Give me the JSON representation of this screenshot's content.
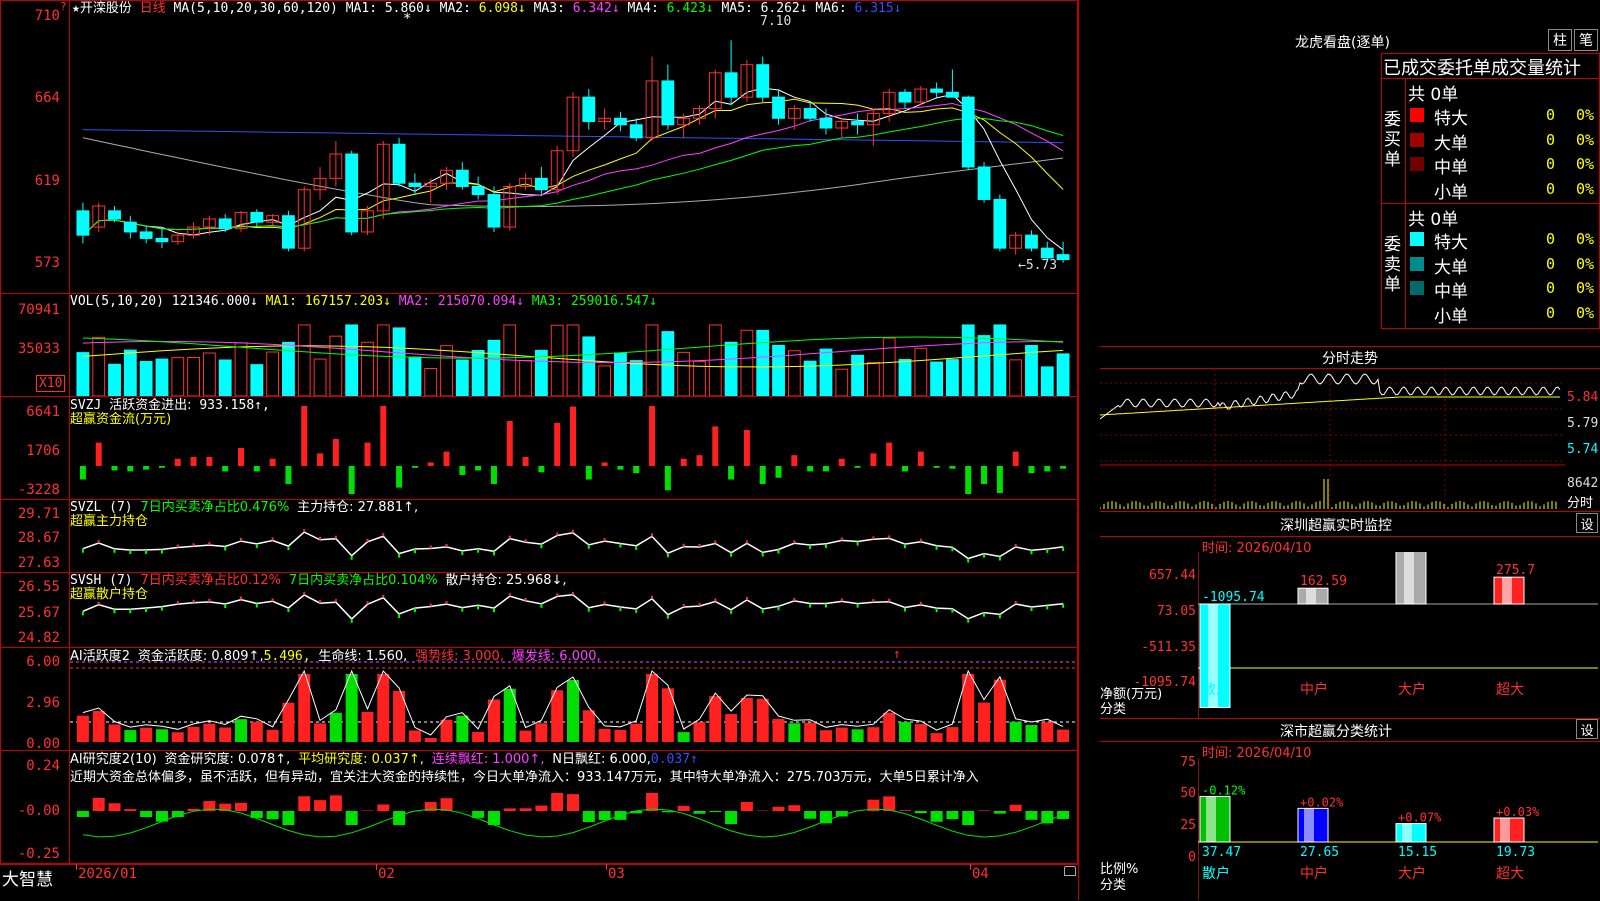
{
  "stock": {
    "star": "★",
    "name": "开滦股份",
    "period": "日线"
  },
  "main_panel": {
    "ma_header": "MA(5,10,20,30,60,120)",
    "ma": [
      {
        "label": "MA1:",
        "value": "5.860↓",
        "color": "#ffffff"
      },
      {
        "label": "MA2:",
        "value": "6.098↓",
        "color": "#ffff00"
      },
      {
        "label": "MA3:",
        "value": "6.342↓",
        "color": "#ff40ff"
      },
      {
        "label": "MA4:",
        "value": "6.423↓",
        "color": "#00ff00"
      },
      {
        "label": "MA5:",
        "value": "6.262↓",
        "color": "#ffffff"
      },
      {
        "label": "MA6:",
        "value": "6.315↓",
        "color": "#3050ff"
      }
    ],
    "y_labels": [
      "710",
      "664",
      "619",
      "573"
    ],
    "high_mark": "7.10",
    "low_mark": "←5.73",
    "star_mark": "*"
  },
  "vol_panel": {
    "header": "VOL(5,10,20)",
    "value": "121346.000↓",
    "ma": [
      {
        "label": "MA1:",
        "value": "167157.203↓",
        "color": "#ffff00"
      },
      {
        "label": "MA2:",
        "value": "215070.094↓",
        "color": "#ff40ff"
      },
      {
        "label": "MA3:",
        "value": "259016.547↓",
        "color": "#00ff00"
      }
    ],
    "y_labels": [
      "70941",
      "35033"
    ],
    "unit": "X10"
  },
  "svzj_panel": {
    "header": "SVZJ",
    "text1": "活跃资金进出:",
    "value1": "933.158↑,",
    "text2": "超赢资金流(万元)",
    "y_labels": [
      "6641",
      "1706",
      "-3228"
    ]
  },
  "svzl_panel": {
    "header": "SVZL (7)",
    "text1": "7日内买卖净占比0.476%",
    "text2": "主力持仓: 27.881↑,",
    "text3": "超赢主力持仓",
    "y_labels": [
      "29.71",
      "28.67",
      "27.63"
    ]
  },
  "svsh_panel": {
    "header": "SVSH (7)",
    "text1": "7日内买卖净占比0.12%",
    "text2": "7日内买卖净占比0.104%",
    "text3": "散户持仓: 25.968↓,",
    "text4": "超赢散户持仓",
    "y_labels": [
      "26.55",
      "25.67",
      "24.82"
    ]
  },
  "ai_act_panel": {
    "header": "AI活跃度2",
    "text1": "资金活跃度: 0.809↑,",
    "text2": "5.496,",
    "text3": "生命线: 1.560,",
    "text4": "强势线: 3.000,",
    "text5": "爆发线: 6.000,",
    "arrow": "↑",
    "y_labels": [
      "6.00",
      "2.96",
      "0.00"
    ]
  },
  "ai_res_panel": {
    "header": "AI研究度2(10)",
    "text1": "资金研究度: 0.078↑,",
    "text2": "平均研究度: 0.037↑,",
    "text3": "连续飘红: 1.000↑,",
    "text4": "N日飘红: 6.000,",
    "text5": "0.037↑",
    "comment": "近期大资金总体偏多，虽不活跃，但有异动，宜关注大资金的持续性，今日大单净流入：933.147万元，其中特大单净流入：275.703万元，大单5日累计净入",
    "y_labels": [
      "0.24",
      "-0.00",
      "-0.25"
    ]
  },
  "bottom_bar": {
    "brand": "大智慧",
    "dates": [
      "2026/01",
      "02",
      "03",
      "04"
    ],
    "lock": "🔒"
  },
  "longhu": {
    "title": "龙虎看盘(逐单)",
    "btn_zhu": "柱",
    "btn_bi": "笔",
    "subtitle": "已成交委托单成交量统计",
    "buy_side": "委买单",
    "sell_side": "委卖单",
    "buy_total": "共 0单",
    "sell_total": "共 0单",
    "buy_rows": [
      {
        "label": "特大",
        "count": "0",
        "pct": "0%",
        "color": "#ff0000"
      },
      {
        "label": "大单",
        "count": "0",
        "pct": "0%",
        "color": "#a00000"
      },
      {
        "label": "中单",
        "count": "0",
        "pct": "0%",
        "color": "#700000"
      },
      {
        "label": "小单",
        "count": "0",
        "pct": "0%",
        "color": ""
      }
    ],
    "sell_rows": [
      {
        "label": "特大",
        "count": "0",
        "pct": "0%",
        "color": "#00ffff"
      },
      {
        "label": "大单",
        "count": "0",
        "pct": "0%",
        "color": "#008c8c"
      },
      {
        "label": "中单",
        "count": "0",
        "pct": "0%",
        "color": "#006a6a"
      },
      {
        "label": "小单",
        "count": "0",
        "pct": "0%",
        "color": ""
      }
    ]
  },
  "intraday": {
    "title": "分时走势",
    "y_labels": [
      "5.84",
      "5.79",
      "5.74"
    ],
    "vol_label": "8642",
    "time_label": "分时"
  },
  "sz_monitor": {
    "title": "深圳超赢实时监控",
    "btn": "设",
    "time": "时间: 2026/04/10",
    "y_labels": [
      "657.44",
      "73.05",
      "-511.35",
      "-1095.74"
    ],
    "net_label1": "净额(万元)",
    "net_label2": "分类",
    "categories": [
      "散户",
      "中户",
      "大户",
      "超大"
    ],
    "values": [
      "-1095.74",
      "162.59",
      "657.44",
      "275.7"
    ]
  },
  "sz_class": {
    "title": "深市超赢分类统计",
    "btn": "设",
    "time": "时间: 2026/04/10",
    "y_labels": [
      "75",
      "50",
      "25",
      "0"
    ],
    "ratio_label1": "比例%",
    "ratio_label2": "分类",
    "categories": [
      "散户",
      "中户",
      "大户",
      "超大"
    ],
    "changes": [
      "-0.12%",
      "+0.02%",
      "+0.07%",
      "+0.03%"
    ],
    "values": [
      "37.47",
      "27.65",
      "15.15",
      "19.73"
    ]
  },
  "chart_data": [
    {
      "type": "candlestick",
      "title": "开滦股份 日线",
      "ylim": [
        5.55,
        7.25
      ],
      "y_ticks": [
        7.1,
        6.64,
        6.19,
        5.73
      ],
      "x_ticks": [
        "2026/01",
        "02",
        "03",
        "04"
      ],
      "candles": [
        [
          6.05,
          6.1,
          5.85,
          5.9
        ],
        [
          5.95,
          6.1,
          5.92,
          6.08
        ],
        [
          6.05,
          6.08,
          5.98,
          6.0
        ],
        [
          5.98,
          6.02,
          5.88,
          5.92
        ],
        [
          5.92,
          5.96,
          5.85,
          5.88
        ],
        [
          5.88,
          5.95,
          5.82,
          5.86
        ],
        [
          5.86,
          5.92,
          5.84,
          5.9
        ],
        [
          5.9,
          5.98,
          5.88,
          5.95
        ],
        [
          5.95,
          6.02,
          5.9,
          6.0
        ],
        [
          6.0,
          6.03,
          5.92,
          5.94
        ],
        [
          5.94,
          6.05,
          5.92,
          6.04
        ],
        [
          6.04,
          6.06,
          5.95,
          5.98
        ],
        [
          5.98,
          6.03,
          5.96,
          6.02
        ],
        [
          6.02,
          6.05,
          5.8,
          5.82
        ],
        [
          5.82,
          6.2,
          5.8,
          6.18
        ],
        [
          6.18,
          6.32,
          6.12,
          6.25
        ],
        [
          6.25,
          6.48,
          6.2,
          6.4
        ],
        [
          6.4,
          6.42,
          5.9,
          5.92
        ],
        [
          5.92,
          6.08,
          5.9,
          6.05
        ],
        [
          6.05,
          6.48,
          6.0,
          6.46
        ],
        [
          6.46,
          6.5,
          6.2,
          6.22
        ],
        [
          6.22,
          6.28,
          6.15,
          6.2
        ],
        [
          6.2,
          6.25,
          6.1,
          6.22
        ],
        [
          6.22,
          6.32,
          6.18,
          6.3
        ],
        [
          6.3,
          6.35,
          6.18,
          6.2
        ],
        [
          6.2,
          6.26,
          6.12,
          6.15
        ],
        [
          6.15,
          6.2,
          5.92,
          5.95
        ],
        [
          5.95,
          6.22,
          5.93,
          6.2
        ],
        [
          6.2,
          6.28,
          6.18,
          6.25
        ],
        [
          6.25,
          6.32,
          6.15,
          6.18
        ],
        [
          6.18,
          6.45,
          6.15,
          6.42
        ],
        [
          6.42,
          6.78,
          6.38,
          6.75
        ],
        [
          6.75,
          6.8,
          6.55,
          6.6
        ],
        [
          6.6,
          6.68,
          6.55,
          6.62
        ],
        [
          6.62,
          6.66,
          6.54,
          6.58
        ],
        [
          6.58,
          6.62,
          6.48,
          6.5
        ],
        [
          6.5,
          7.0,
          6.48,
          6.85
        ],
        [
          6.85,
          6.95,
          6.55,
          6.58
        ],
        [
          6.58,
          6.65,
          6.5,
          6.62
        ],
        [
          6.62,
          6.7,
          6.58,
          6.68
        ],
        [
          6.68,
          6.92,
          6.62,
          6.9
        ],
        [
          6.9,
          7.1,
          6.7,
          6.75
        ],
        [
          6.75,
          6.98,
          6.72,
          6.95
        ],
        [
          6.95,
          7.0,
          6.72,
          6.75
        ],
        [
          6.75,
          6.8,
          6.58,
          6.62
        ],
        [
          6.62,
          6.7,
          6.55,
          6.68
        ],
        [
          6.68,
          6.72,
          6.6,
          6.62
        ],
        [
          6.62,
          6.68,
          6.52,
          6.56
        ],
        [
          6.56,
          6.62,
          6.5,
          6.6
        ],
        [
          6.6,
          6.65,
          6.52,
          6.58
        ],
        [
          6.58,
          6.68,
          6.45,
          6.65
        ],
        [
          6.65,
          6.8,
          6.6,
          6.78
        ],
        [
          6.78,
          6.8,
          6.68,
          6.72
        ],
        [
          6.72,
          6.82,
          6.7,
          6.8
        ],
        [
          6.8,
          6.84,
          6.74,
          6.78
        ],
        [
          6.78,
          6.92,
          6.75,
          6.75
        ],
        [
          6.75,
          6.76,
          6.3,
          6.32
        ],
        [
          6.32,
          6.35,
          6.1,
          6.12
        ],
        [
          6.12,
          6.15,
          5.8,
          5.82
        ],
        [
          5.82,
          5.92,
          5.78,
          5.9
        ],
        [
          5.9,
          5.93,
          5.8,
          5.82
        ],
        [
          5.82,
          5.86,
          5.75,
          5.76
        ],
        [
          5.78,
          5.86,
          5.73,
          5.75
        ]
      ],
      "ma_lines": [
        "MA1",
        "MA2",
        "MA3",
        "MA4",
        "MA5",
        "MA6"
      ]
    },
    {
      "type": "bar",
      "title": "VOL(5,10,20)",
      "y_ticks": [
        70941,
        35033
      ],
      "note": "unit X10"
    }
  ]
}
